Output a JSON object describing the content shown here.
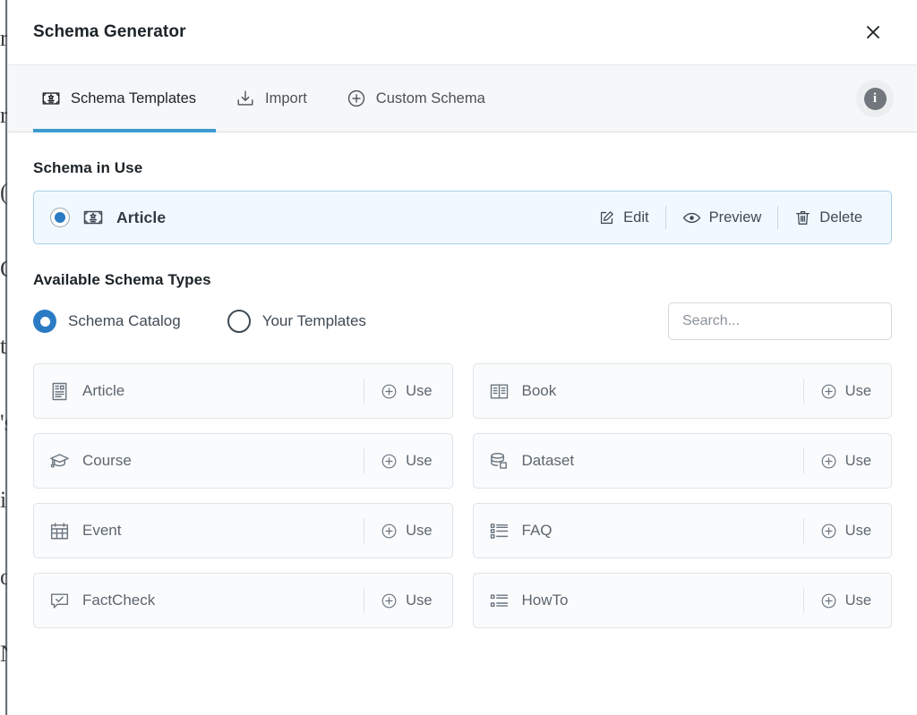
{
  "background": {
    "edge_glyphs": "ri\nre\n(\nG\nt\n's\ni\no\nN"
  },
  "header": {
    "title": "Schema Generator",
    "close_icon": "close-icon"
  },
  "tabs": {
    "items": [
      {
        "label": "Schema Templates",
        "icon": "certificate-icon",
        "active": true
      },
      {
        "label": "Import",
        "icon": "download-icon",
        "active": false
      },
      {
        "label": "Custom Schema",
        "icon": "plus-circle-icon",
        "active": false
      }
    ],
    "info_icon": "info-icon",
    "info_glyph": "i",
    "active_underline_color": "#3d9bd0"
  },
  "schema_in_use": {
    "heading": "Schema in Use",
    "item": {
      "name": "Article",
      "icon": "certificate-icon",
      "selected": true,
      "radio_color": "#2b7bc4"
    },
    "actions": [
      {
        "label": "Edit",
        "icon": "edit-pencil-icon"
      },
      {
        "label": "Preview",
        "icon": "eye-icon"
      },
      {
        "label": "Delete",
        "icon": "trash-icon"
      }
    ],
    "card_border_color": "#a8cfe9",
    "card_background_color": "#f2f9fe"
  },
  "available": {
    "heading": "Available Schema Types",
    "filters": [
      {
        "label": "Schema Catalog",
        "selected": true
      },
      {
        "label": "Your Templates",
        "selected": false
      }
    ],
    "search": {
      "placeholder": "Search...",
      "value": ""
    },
    "use_label": "Use",
    "types": [
      {
        "name": "Article",
        "icon": "article-document-icon"
      },
      {
        "name": "Book",
        "icon": "open-book-icon"
      },
      {
        "name": "Course",
        "icon": "graduation-cap-icon"
      },
      {
        "name": "Dataset",
        "icon": "database-stack-icon"
      },
      {
        "name": "Event",
        "icon": "calendar-icon"
      },
      {
        "name": "FAQ",
        "icon": "bullet-list-icon"
      },
      {
        "name": "FactCheck",
        "icon": "speech-bubble-check-icon"
      },
      {
        "name": "HowTo",
        "icon": "ordered-list-icon"
      }
    ]
  }
}
